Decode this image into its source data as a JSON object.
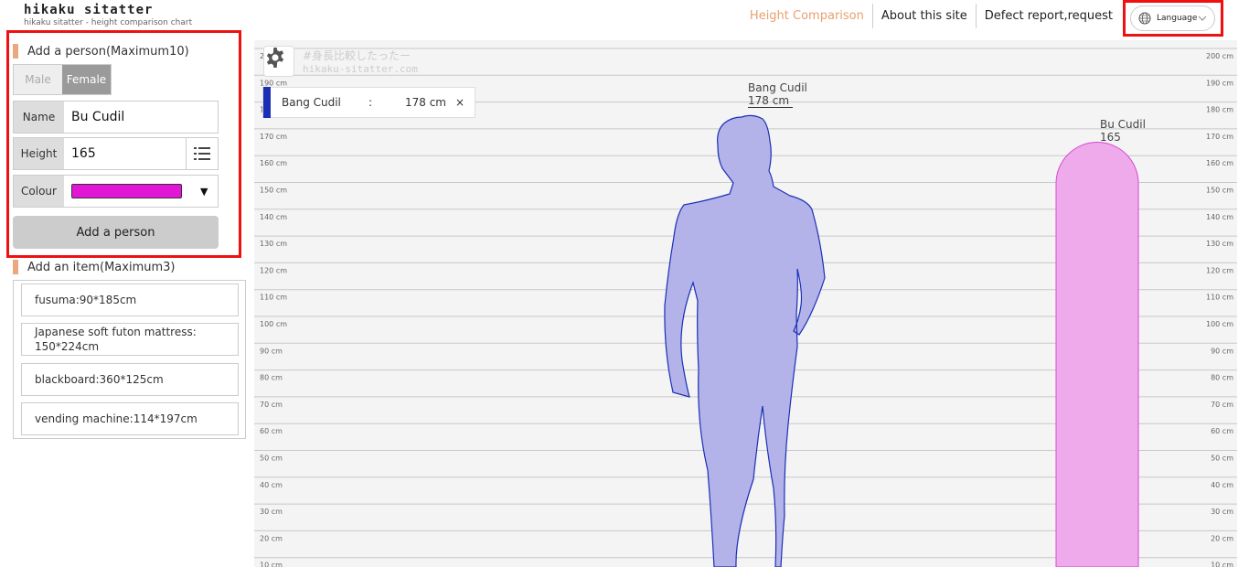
{
  "header": {
    "logo_title": "hikaku sitatter",
    "logo_subtitle": "hikaku sitatter - height comparison chart",
    "nav": [
      "Height Comparison",
      "About this site",
      "Defect report,request"
    ],
    "language_label": "Language"
  },
  "add_person": {
    "title": "Add a person(Maximum10)",
    "gender_options": [
      "Male",
      "Female"
    ],
    "selected_gender": "Female",
    "name_label": "Name",
    "name_value": "Bu Cudil",
    "height_label": "Height",
    "height_value": "165",
    "colour_label": "Colour",
    "colour_value": "#e316d6",
    "button_label": "Add a person"
  },
  "add_item": {
    "title": "Add an item(Maximum3)",
    "items": [
      "fusuma:90*185cm",
      "Japanese soft futon mattress: 150*224cm",
      "blackboard:360*125cm",
      "vending machine:114*197cm"
    ]
  },
  "chart": {
    "watermark_line1": "#身長比較したったー",
    "watermark_line2": "hikaku-sitatter.com",
    "people": [
      {
        "name": "Bang Cudil",
        "height_cm": 178,
        "height_label": "178 cm",
        "color": "#1a2fb5",
        "fill": "#b3b3ea",
        "shape": "male-silhouette"
      },
      {
        "name": "Bu Cudil",
        "height_cm": 165,
        "height_label": "165",
        "color": "#d54cd3",
        "fill": "#eeaaea",
        "shape": "pill"
      }
    ],
    "chip": {
      "name": "Bang Cudil",
      "separator": ":",
      "height": "178 cm",
      "close": "×"
    }
  },
  "chart_data": {
    "type": "bar",
    "categories": [
      "Bang Cudil",
      "Bu Cudil"
    ],
    "values": [
      178,
      165
    ],
    "ylim": [
      0,
      200
    ],
    "tick_step": 10,
    "unit": "cm"
  }
}
